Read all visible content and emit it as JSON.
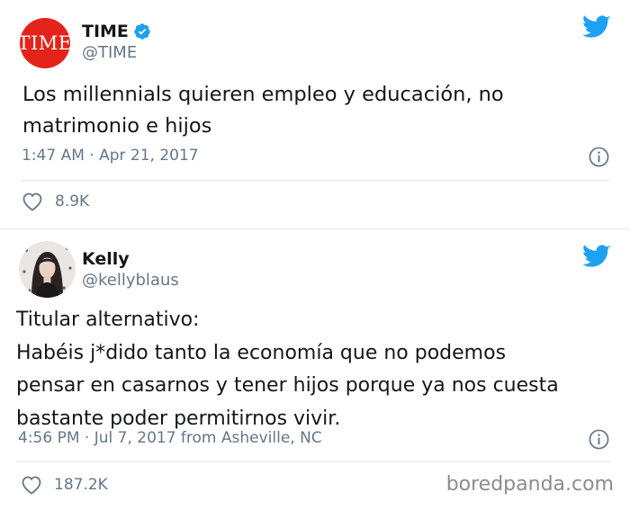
{
  "tweets": [
    {
      "author_name": "TIME",
      "handle": "@TIME",
      "avatar_text": "TIME",
      "verified": true,
      "text_lines": [
        "Los millennials quieren empleo y educación, no",
        "matrimonio e hijos"
      ],
      "meta": "1:47 AM · Apr 21, 2017",
      "likes": "8.9K"
    },
    {
      "author_name": "Kelly",
      "handle": "@kellyblaus",
      "verified": false,
      "text_lines": [
        "Titular alternativo:",
        "Habéis j*dido tanto la economía que no podemos",
        "pensar en casarnos y tener hijos porque ya nos cuesta",
        "bastante poder permitirnos vivir."
      ],
      "meta": "4:56 PM · Jul 7, 2017 from Asheville, NC",
      "likes": "187.2K"
    }
  ],
  "watermark": "boredpanda.com",
  "colors": {
    "twitter_blue": "#1da1f2",
    "time_red": "#e4241b",
    "secondary_text": "#657786",
    "divider": "#e1e8ed"
  },
  "icons": {
    "platform": "twitter-bird-icon",
    "verified": "verified-badge-icon",
    "info": "info-icon",
    "like": "heart-icon"
  }
}
